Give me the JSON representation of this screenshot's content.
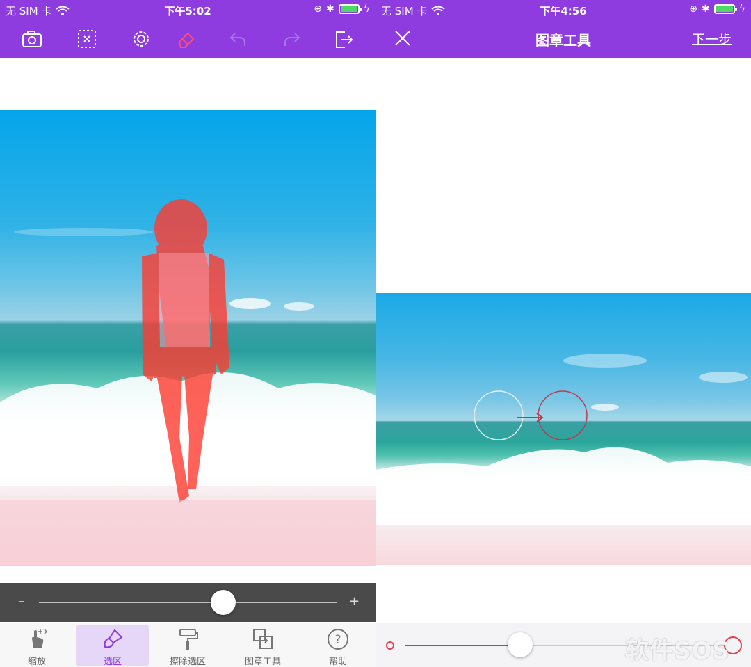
{
  "left": {
    "status": {
      "carrier": "无 SIM 卡",
      "time": "下午5:02"
    },
    "toolbar": {
      "icons": [
        "camera-icon",
        "clear-selection-icon",
        "settings-gear-icon",
        "eraser-icon",
        "undo-icon",
        "redo-icon",
        "export-icon"
      ],
      "active_icon": "eraser-icon",
      "disabled_icons": [
        "undo-icon",
        "redo-icon"
      ]
    },
    "slider": {
      "minus": "–",
      "plus": "+",
      "value": 0.62
    },
    "tabs": [
      {
        "label": "缩放",
        "icon": "pan-zoom-hand-icon",
        "active": false
      },
      {
        "label": "选区",
        "icon": "brush-icon",
        "active": true
      },
      {
        "label": "擦除选区",
        "icon": "paint-roller-icon",
        "active": false
      },
      {
        "label": "图章工具",
        "icon": "clone-stamp-icon",
        "active": false
      },
      {
        "label": "帮助",
        "icon": "help-icon",
        "active": false
      }
    ]
  },
  "right": {
    "status": {
      "carrier": "无 SIM 卡",
      "time": "下午4:56"
    },
    "nav": {
      "title": "图章工具",
      "next": "下一步"
    },
    "slider": {
      "value": 0.36
    },
    "watermark": "软件SOS"
  },
  "colors": {
    "accent": "#8e3be0",
    "selection_overlay": "#ff3b30"
  }
}
